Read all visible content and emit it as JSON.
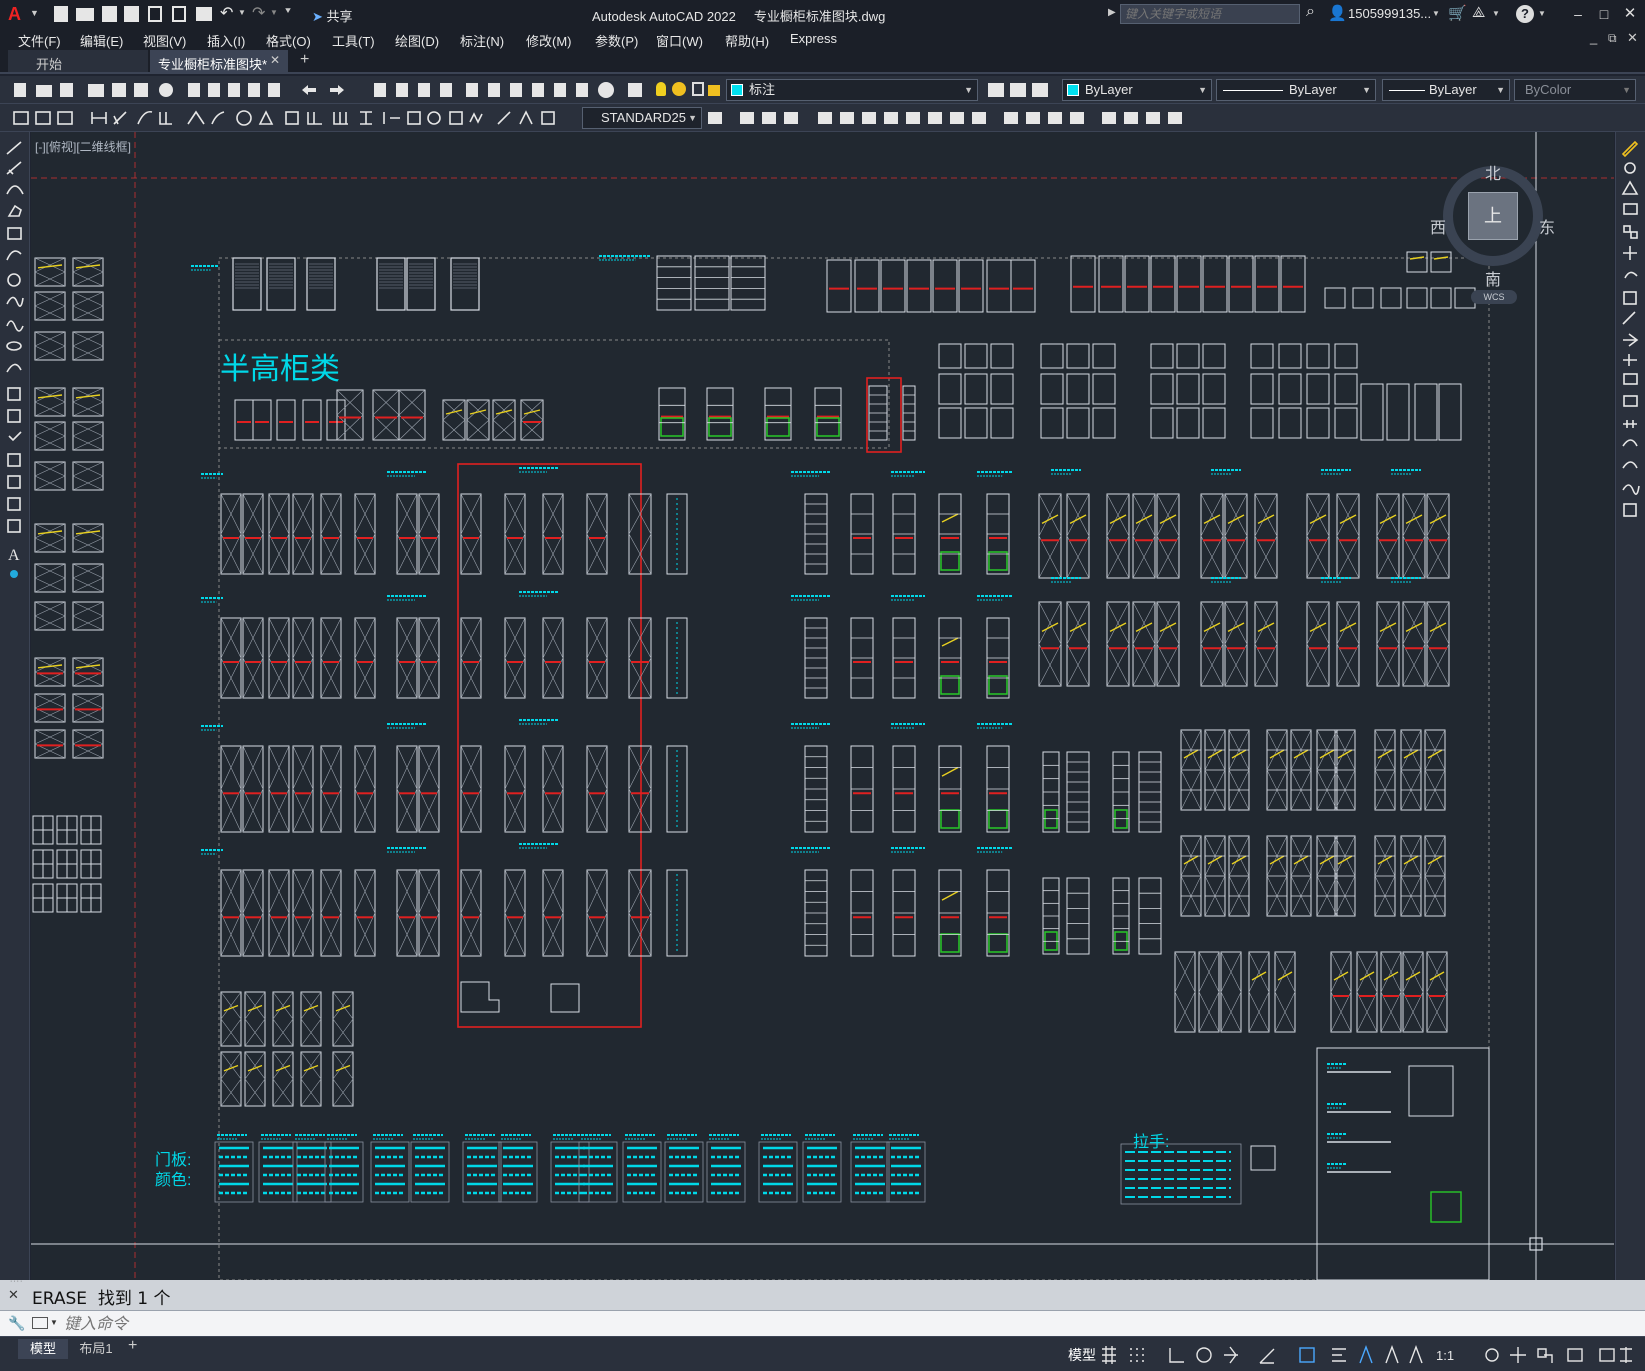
{
  "window": {
    "app_title": "Autodesk AutoCAD 2022",
    "file_title": "专业橱柜标准图块.dwg",
    "search_placeholder": "键入关键字或短语",
    "user": "1505999135...",
    "share_label": "共享"
  },
  "menu": [
    "文件(F)",
    "编辑(E)",
    "视图(V)",
    "插入(I)",
    "格式(O)",
    "工具(T)",
    "绘图(D)",
    "标注(N)",
    "修改(M)",
    "参数(P)",
    "窗口(W)",
    "帮助(H)",
    "Express"
  ],
  "tabs": {
    "start": "开始",
    "doc": "专业橱柜标准图块*"
  },
  "toolbar": {
    "layer_name": "标注",
    "color": "ByLayer",
    "linetype": "ByLayer",
    "lineweight": "ByLayer",
    "plotstyle": "ByColor",
    "dimstyle": "STANDARD25"
  },
  "viewport": {
    "label": "[-][俯视][二维线框]"
  },
  "viewcube": {
    "north": "北",
    "south": "南",
    "east": "东",
    "west": "西",
    "top": "上",
    "wcs": "WCS"
  },
  "drawing": {
    "heading": "半高柜类",
    "door_label": "门板:",
    "color_label": "颜色:",
    "handle_label": "拉手:"
  },
  "command": {
    "history": "ERASE  找到 1 个",
    "placeholder": "键入命令"
  },
  "layout_tabs": [
    "模型",
    "布局1"
  ],
  "status": {
    "model": "模型",
    "scale": "1:1"
  },
  "colors": {
    "canvas_bg": "#212830",
    "cyan": "#00d8e8",
    "white_line": "#d8dde4",
    "red": "#e02020",
    "green": "#28c828",
    "yellow": "#e8d020"
  }
}
